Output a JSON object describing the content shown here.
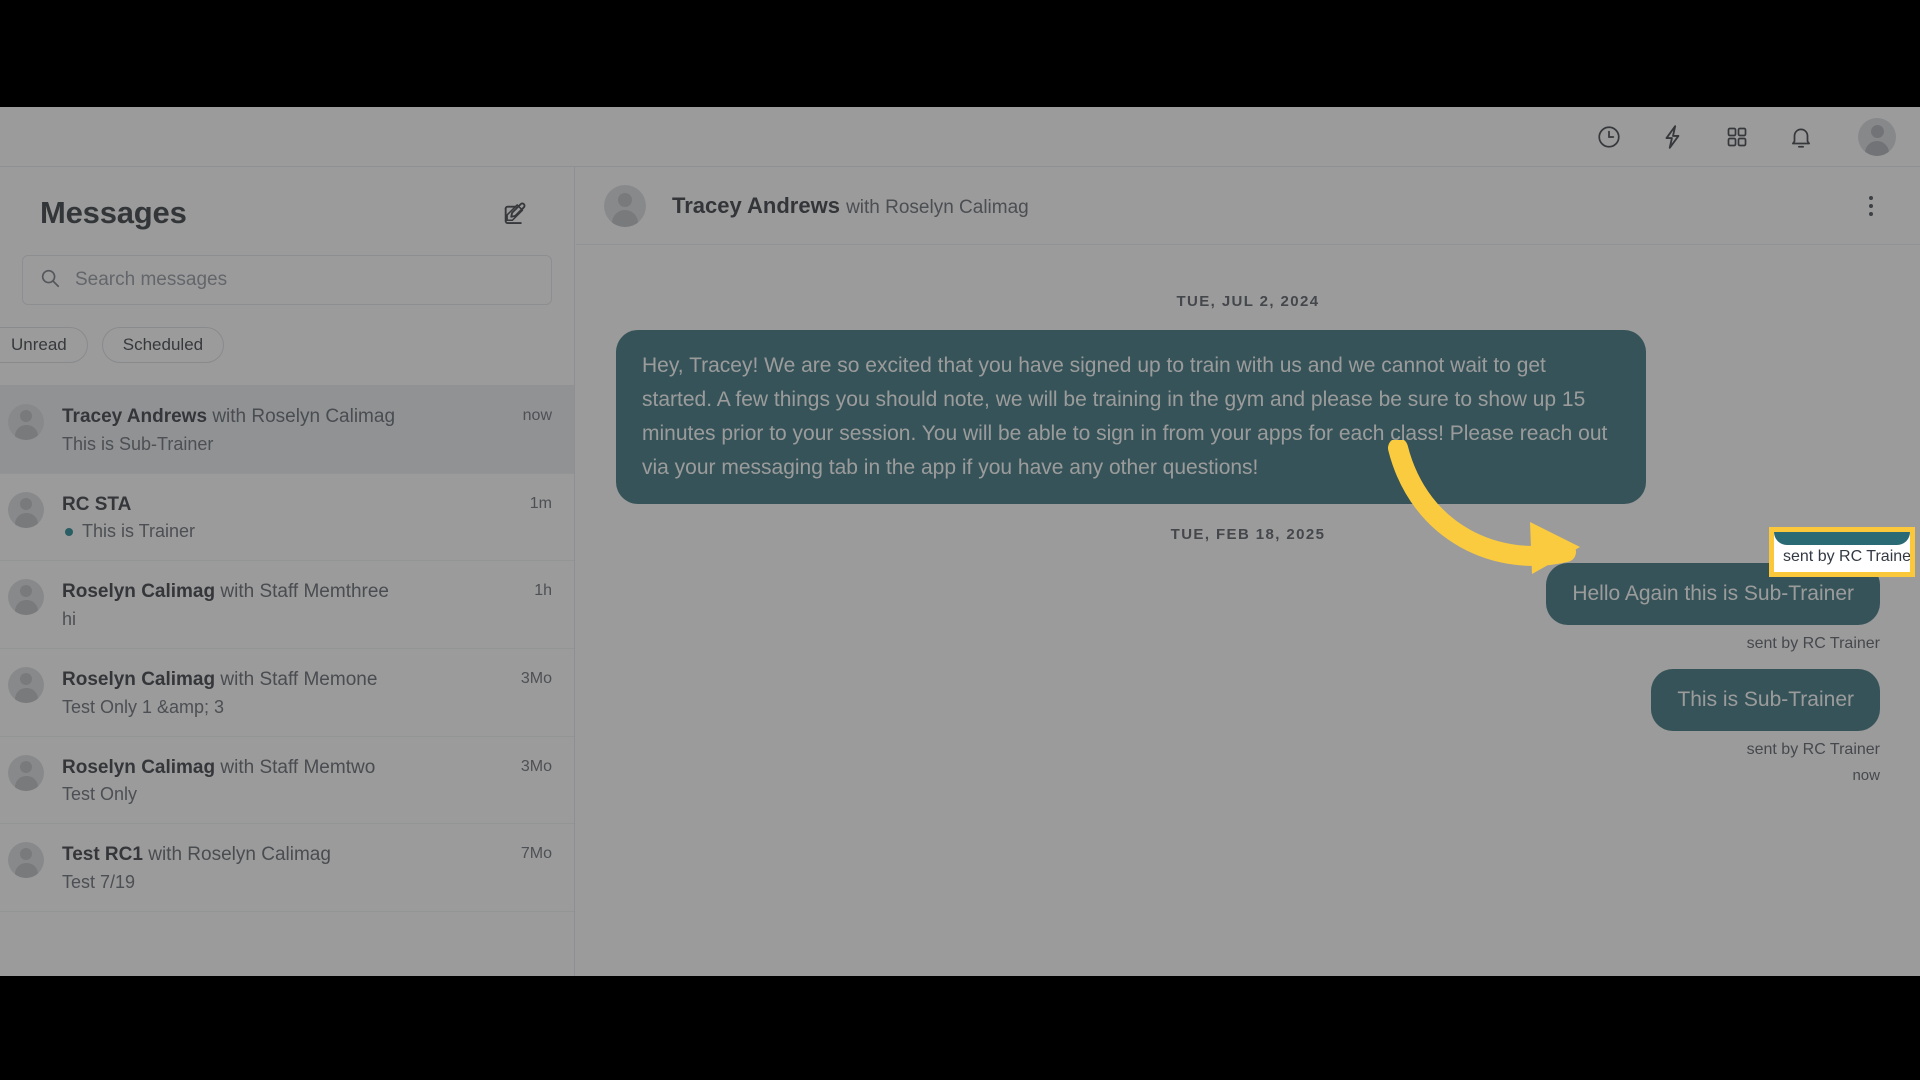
{
  "topbar": {
    "icons": [
      {
        "name": "clock-icon",
        "label": "Recent"
      },
      {
        "name": "lightning-bolt-icon",
        "label": "Quick actions"
      },
      {
        "name": "apps-grid-icon",
        "label": "Apps"
      },
      {
        "name": "bell-icon",
        "label": "Notifications"
      }
    ],
    "avatar_label": "Account"
  },
  "sidebar": {
    "title": "Messages",
    "compose_label": "Compose message",
    "search": {
      "placeholder": "Search messages",
      "value": ""
    },
    "filters": [
      {
        "label": "Unread",
        "active": false
      },
      {
        "label": "Scheduled",
        "active": false
      }
    ],
    "conversations": [
      {
        "who": "Tracey Andrews",
        "with": "with Roselyn Calimag",
        "preview": "This is Sub-Trainer",
        "time": "now",
        "unread": false,
        "selected": true
      },
      {
        "who": "RC STA",
        "with": "",
        "preview": "This is Trainer",
        "time": "1m",
        "unread": true,
        "selected": false
      },
      {
        "who": "Roselyn Calimag",
        "with": "with Staff Memthree",
        "preview": "hi",
        "time": "1h",
        "unread": false,
        "selected": false
      },
      {
        "who": "Roselyn Calimag",
        "with": "with Staff Memone",
        "preview": "Test Only 1 &amp; 3",
        "time": "3Mo",
        "unread": false,
        "selected": false
      },
      {
        "who": "Roselyn Calimag",
        "with": "with Staff Memtwo",
        "preview": "Test Only",
        "time": "3Mo",
        "unread": false,
        "selected": false
      },
      {
        "who": "Test RC1",
        "with": "with Roselyn Calimag",
        "preview": "Test 7/19",
        "time": "7Mo",
        "unread": false,
        "selected": false
      }
    ]
  },
  "thread": {
    "header": {
      "who": "Tracey Andrews",
      "with": "with Roselyn Calimag",
      "menu_label": "More options"
    },
    "date_separator_1": "TUE, JUL 2, 2024",
    "date_separator_2": "TUE, FEB 18, 2025",
    "messages": [
      {
        "side": "left",
        "text": "Hey, Tracey! We are so excited that you have signed up to train with us and we cannot wait to get started. A few things you should note, we will be training in the gym and please be sure to show up 15 minutes prior to your session. You will be able to sign in from your apps for each class! Please reach out via your messaging tab in the app if you have any other questions!"
      },
      {
        "side": "right",
        "text": "Hello Again this is Sub-Trainer"
      },
      {
        "side": "right",
        "text": "This is Sub-Trainer"
      }
    ],
    "sent_by_label": "sent by RC Trainer",
    "last_timestamp": "now"
  },
  "highlight": {
    "text": "sent by RC Trainer",
    "border_color": "#fbc73b"
  },
  "colors": {
    "bubble": "#2a6a74",
    "accent": "#11818c",
    "highlight": "#fbc73b",
    "topbar_bg": "#ffffff"
  }
}
